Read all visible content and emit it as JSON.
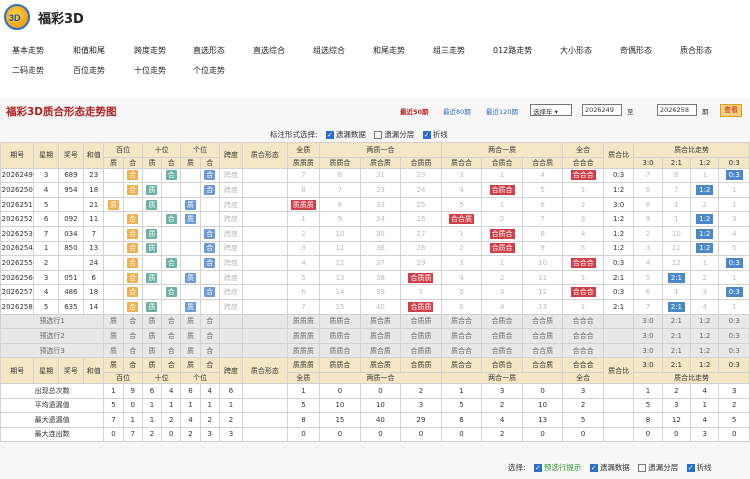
{
  "site": {
    "logo": "3D",
    "name": "福彩3D"
  },
  "nav": [
    [
      "基本走势",
      12,
      45
    ],
    [
      "和值和尾",
      73,
      45
    ],
    [
      "跨度走势",
      134,
      45
    ],
    [
      "直选形态",
      193,
      45
    ],
    [
      "直选综合",
      253,
      45
    ],
    [
      "组选综合",
      313,
      45
    ],
    [
      "和尾走势",
      373,
      45
    ],
    [
      "组三走势",
      433,
      45
    ],
    [
      "012路走势",
      493,
      45
    ],
    [
      "大小形态",
      560,
      45
    ],
    [
      "奇偶形态",
      620,
      45
    ],
    [
      "质合形态",
      680,
      45
    ],
    [
      "二码走势",
      12,
      65
    ],
    [
      "百位走势",
      73,
      65
    ],
    [
      "十位走势",
      134,
      65
    ],
    [
      "个位走势",
      193,
      65
    ]
  ],
  "panel": {
    "title": "福彩3D质合形态走势图",
    "r50": "最近50期",
    "r80": "最近80期",
    "r120": "最近120期",
    "sel": "选择年",
    "from": "2026249",
    "to_label": "至",
    "to": "2026258",
    "unit": "期",
    "query": "查看"
  },
  "opts": {
    "label": "标注形式选择:",
    "a": "遗漏数据",
    "b": "遗漏分层",
    "c": "折线"
  },
  "opts2": {
    "label": "选择:",
    "a": "预选行提示",
    "b": "遗漏数据",
    "c": "遗漏分层",
    "d": "折线"
  },
  "head": {
    "qh": "期号",
    "xq": "星期",
    "jh": "奖号",
    "hz": "和值",
    "bw": "百位",
    "sw": "十位",
    "gw": "个位",
    "kd": "跨度",
    "zhxt": "质合形态",
    "qz": "全质",
    "lyh": "两质一合",
    "lhy": "两合一质",
    "qh2": "全合",
    "zhb": "质合比",
    "zhbzs": "质合比走势",
    "z": "质",
    "h": "合",
    "zzz": "质质质",
    "zzh": "质质合",
    "zhz": "质合质",
    "hzz": "合质质",
    "zhh": "质合合",
    "hzh": "合质合",
    "hhz": "合合质",
    "hhh": "合合合",
    "r1": "3:0",
    "r2": "2:1",
    "r3": "1:2",
    "r4": "0:3"
  },
  "rows": [
    [
      "2026249",
      "3",
      "689",
      "23",
      "合",
      "合",
      "合",
      "7",
      "6",
      "31",
      "23",
      "3",
      "1",
      "4",
      "合合合",
      "0:3",
      "7",
      "6",
      "1",
      "0:3"
    ],
    [
      "2026250",
      "4",
      "954",
      "18",
      "合",
      "质",
      "合",
      "8",
      "7",
      "33",
      "24",
      "4",
      "合质合",
      "5",
      "1",
      "1:2",
      "8",
      "7",
      "1:2",
      "1"
    ],
    [
      "2026251",
      "5",
      "777",
      "21",
      "质",
      "质",
      "质",
      "质质质",
      "8",
      "33",
      "25",
      "5",
      "1",
      "6",
      "2",
      "3:0",
      "8",
      "1",
      "2",
      "1"
    ],
    [
      "2026252",
      "6",
      "092",
      "11",
      "合",
      "合",
      "质",
      "1",
      "9",
      "34",
      "26",
      "合合质",
      "2",
      "7",
      "3",
      "1:2",
      "9",
      "1",
      "1:2",
      "3"
    ],
    [
      "2026253",
      "7",
      "034",
      "7",
      "合",
      "质",
      "合",
      "2",
      "10",
      "35",
      "27",
      "1",
      "合质合",
      "8",
      "4",
      "1:2",
      "2",
      "10",
      "1:2",
      "4"
    ],
    [
      "2026254",
      "1",
      "850",
      "13",
      "合",
      "质",
      "合",
      "3",
      "11",
      "36",
      "28",
      "2",
      "合质合",
      "9",
      "5",
      "1:2",
      "3",
      "11",
      "1:2",
      "5"
    ],
    [
      "2026255",
      "2",
      "699",
      "24",
      "合",
      "合",
      "合",
      "4",
      "12",
      "37",
      "29",
      "3",
      "1",
      "10",
      "合合合",
      "0:3",
      "4",
      "12",
      "1",
      "0:3"
    ],
    [
      "2026256",
      "3",
      "051",
      "6",
      "合",
      "质",
      "质",
      "5",
      "13",
      "38",
      "合质质",
      "4",
      "2",
      "11",
      "1",
      "2:1",
      "5",
      "2:1",
      "2",
      "1"
    ],
    [
      "2026257",
      "4",
      "486",
      "18",
      "合",
      "合",
      "合",
      "6",
      "14",
      "39",
      "1",
      "5",
      "3",
      "12",
      "合合合",
      "0:3",
      "6",
      "1",
      "3",
      "0:3"
    ],
    [
      "2026258",
      "5",
      "635",
      "14",
      "合",
      "质",
      "质",
      "7",
      "15",
      "40",
      "合质质",
      "6",
      "4",
      "13",
      "1",
      "2:1",
      "7",
      "2:1",
      "4",
      "1"
    ]
  ],
  "pred": [
    "预选行1",
    "预选行2",
    "预选行3"
  ],
  "stats": [
    [
      "出现总次数",
      "1",
      "9",
      "6",
      "4",
      "6",
      "4",
      "6",
      "1",
      "0",
      "0",
      "2",
      "1",
      "3",
      "0",
      "3",
      "1",
      "2",
      "4",
      "3"
    ],
    [
      "平均遗漏值",
      "5",
      "0",
      "1",
      "1",
      "1",
      "1",
      "1",
      "5",
      "10",
      "10",
      "3",
      "5",
      "2",
      "10",
      "2",
      "5",
      "3",
      "1",
      "2"
    ],
    [
      "最大遗漏值",
      "7",
      "1",
      "1",
      "2",
      "4",
      "2",
      "2",
      "8",
      "15",
      "40",
      "29",
      "6",
      "4",
      "13",
      "5",
      "8",
      "12",
      "4",
      "5"
    ],
    [
      "最大连出数",
      "0",
      "7",
      "2",
      "0",
      "2",
      "3",
      "3",
      "0",
      "0",
      "0",
      "0",
      "0",
      "2",
      "0",
      "0",
      "0",
      "0",
      "3",
      "0"
    ]
  ]
}
